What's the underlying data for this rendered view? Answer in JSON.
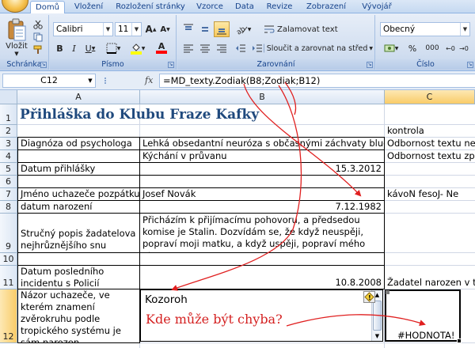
{
  "ribbon": {
    "tabs": [
      {
        "label": "Domů",
        "active": true
      },
      {
        "label": "Vložení"
      },
      {
        "label": "Rozložení stránky"
      },
      {
        "label": "Vzorce"
      },
      {
        "label": "Data"
      },
      {
        "label": "Revize"
      },
      {
        "label": "Zobrazení"
      },
      {
        "label": "Vývojář"
      }
    ],
    "clipboard": {
      "paste_label": "Vložit",
      "group_label": "Schránka"
    },
    "font": {
      "name": "Calibri",
      "size": "11",
      "bold": "B",
      "italic": "I",
      "underline": "U",
      "grow": "A",
      "shrink": "A",
      "color_letter": "A",
      "group_label": "Písmo",
      "fill_color": "#ffff00",
      "font_color": "#ff0000"
    },
    "alignment": {
      "wrap_label": "Zalamovat text",
      "merge_label": "Sloučit a zarovnat na střed",
      "group_label": "Zarovnání"
    },
    "number": {
      "format": "Obecný",
      "currency": "%",
      "percent": "000",
      "group_label": "Číslo"
    }
  },
  "formula_bar": {
    "name_box": "C12",
    "fx": "fx",
    "formula": "=MD_texty.Zodiak(B8;Zodiak;B12)"
  },
  "sheet": {
    "columns": [
      "A",
      "B",
      "C"
    ],
    "rows": [
      "1",
      "2",
      "3",
      "4",
      "5",
      "6",
      "7",
      "8",
      "9",
      "10",
      "11",
      "12"
    ],
    "title": "Přihláška do Klubu Fraze Kafky",
    "c2": "kontrola",
    "a3": "Diagnóza od psychologa",
    "b3": "Lehká obsedantní neuróza s občasnými záchvaty bludů",
    "c3": "Odbornost textu nezpo",
    "b4": "Kýchání v průvanu",
    "c4": "Odbornost textu zpoch",
    "a5": "Datum přihlášky",
    "b5": "15.3.2012",
    "a7": "Jméno uchazeče pozpátku",
    "b7": "Josef Novák",
    "c7": "kávoN fesoJ- Ne",
    "a8": "datum narození",
    "b8": "7.12.1982",
    "a9": "Stručný popis žadatelova nejhrůznějšího snu",
    "b9": "Přicházím k přijímacímu pohovoru, a předsedou komise je Stalin. Dozvídám se, že když neuspěji, popraví moji matku, a když uspěji, popraví mého otce.",
    "a11": "Datum posledního incidentu s Policií",
    "b11": "10.8.2008",
    "c11": "Žadatel narozen v tém",
    "a12": "Názor uchazeče, ve kterém znamení zvěrokruhu podle tropického systému je sám narozen",
    "b12": "Kozoroh",
    "c12": "#HODNOTA!"
  },
  "annotation": {
    "text": "Kde může být chyba?",
    "color": "#d42020"
  }
}
